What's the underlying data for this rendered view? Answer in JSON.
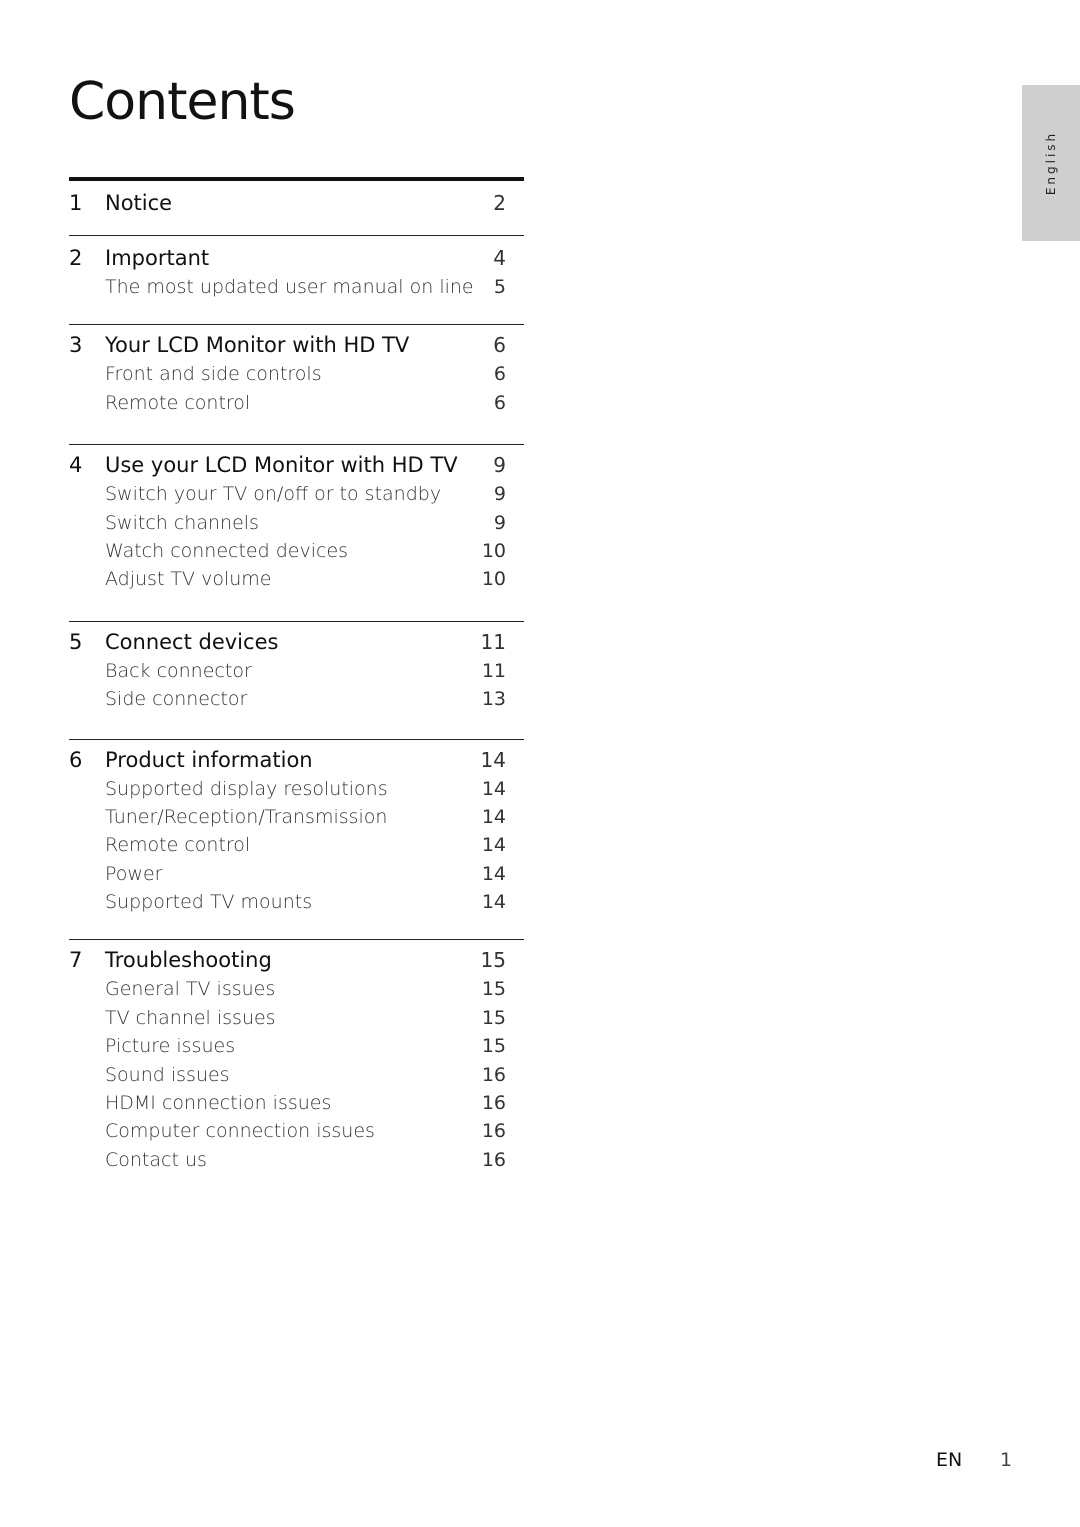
{
  "title": "Contents",
  "language_tab": "English",
  "footer": {
    "lang": "EN",
    "page": "1"
  },
  "sections": [
    {
      "num": "1",
      "title": "Notice",
      "page": "2",
      "items": []
    },
    {
      "num": "2",
      "title": "Important",
      "page": "4",
      "items": [
        {
          "title": "The most updated user manual on line",
          "page": "5"
        }
      ]
    },
    {
      "num": "3",
      "title": "Your LCD Monitor with HD TV",
      "page": "6",
      "items": [
        {
          "title": "Front and side controls",
          "page": "6"
        },
        {
          "title": "Remote control",
          "page": "6"
        }
      ]
    },
    {
      "num": "4",
      "title": "Use your LCD Monitor with HD TV",
      "page": "9",
      "items": [
        {
          "title": "Switch your TV on/off or to standby",
          "page": "9"
        },
        {
          "title": "Switch channels",
          "page": "9"
        },
        {
          "title": "Watch connected devices",
          "page": "10"
        },
        {
          "title": "Adjust TV volume",
          "page": "10"
        }
      ]
    },
    {
      "num": "5",
      "title": "Connect devices",
      "page": "11",
      "items": [
        {
          "title": "Back connector",
          "page": "11"
        },
        {
          "title": "Side connector",
          "page": "13"
        }
      ]
    },
    {
      "num": "6",
      "title": "Product information",
      "page": "14",
      "items": [
        {
          "title": "Supported display resolutions",
          "page": "14"
        },
        {
          "title": "Tuner/Reception/Transmission",
          "page": "14"
        },
        {
          "title": "Remote control",
          "page": "14"
        },
        {
          "title": "Power",
          "page": "14"
        },
        {
          "title": "Supported TV mounts",
          "page": "14"
        }
      ]
    },
    {
      "num": "7",
      "title": "Troubleshooting",
      "page": "15",
      "items": [
        {
          "title": "General TV issues",
          "page": "15"
        },
        {
          "title": "TV channel issues",
          "page": "15"
        },
        {
          "title": "Picture issues",
          "page": "15"
        },
        {
          "title": "Sound issues",
          "page": "16"
        },
        {
          "title": "HDMI connection issues",
          "page": "16"
        },
        {
          "title": "Computer connection issues",
          "page": "16"
        },
        {
          "title": "Contact us",
          "page": "16"
        }
      ]
    }
  ]
}
